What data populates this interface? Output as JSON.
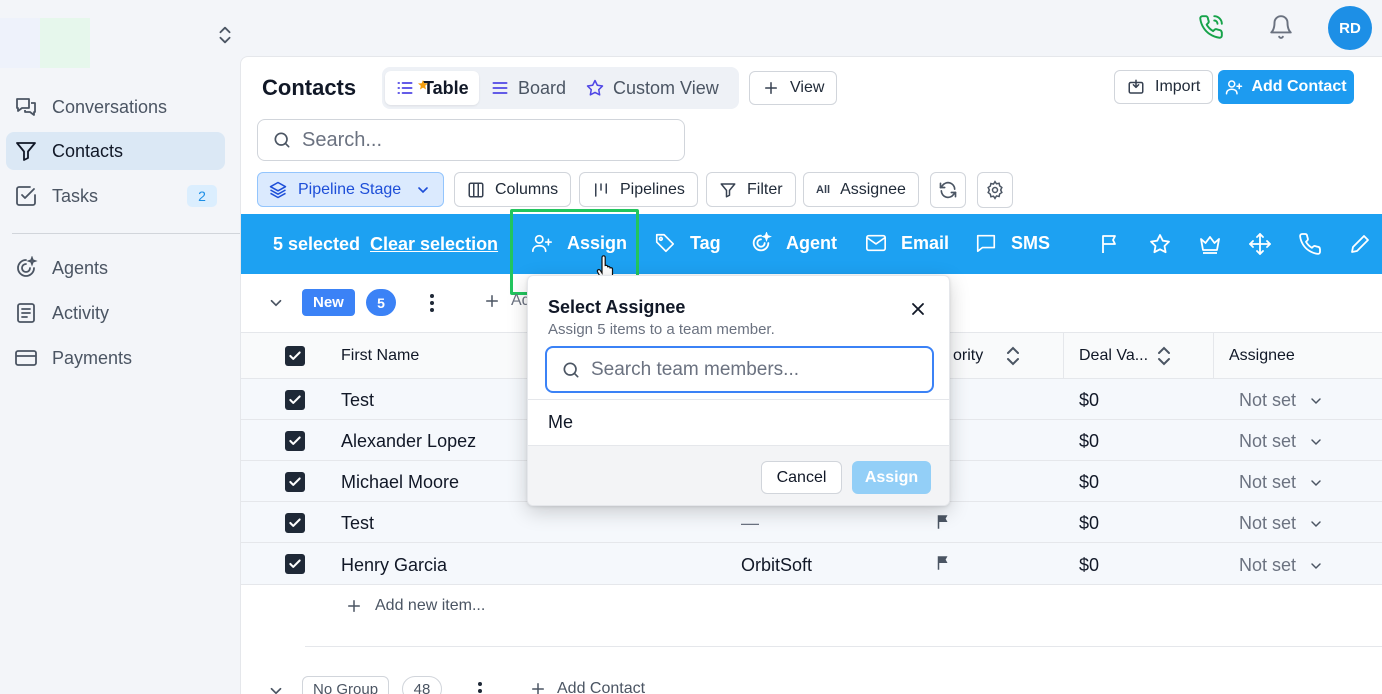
{
  "topbar": {
    "avatar_initials": "RD",
    "icons": [
      "phone-call-icon",
      "bell-icon",
      "workspace-toggle-icon"
    ]
  },
  "sidebar": {
    "items": [
      {
        "label": "Conversations",
        "icon": "conversations-icon"
      },
      {
        "label": "Contacts",
        "icon": "filter-funnel-icon",
        "active": true
      },
      {
        "label": "Tasks",
        "icon": "checkbox-icon",
        "badge": "2"
      },
      {
        "label": "Agents",
        "icon": "agents-icon"
      },
      {
        "label": "Activity",
        "icon": "activity-icon"
      },
      {
        "label": "Payments",
        "icon": "card-icon"
      }
    ]
  },
  "header": {
    "title": "Contacts",
    "tabs": [
      {
        "label": "Table",
        "active": true
      },
      {
        "label": "Board"
      },
      {
        "label": "Custom View"
      }
    ],
    "view_button": "View",
    "import_button": "Import",
    "add_contact_button": "Add Contact"
  },
  "search": {
    "placeholder": "Search..."
  },
  "toolbar": {
    "pipeline_stage": "Pipeline Stage",
    "columns": "Columns",
    "pipelines": "Pipelines",
    "filter": "Filter",
    "assignee_all_badge": "All",
    "assignee": "Assignee"
  },
  "action_bar": {
    "selected_text": "5 selected",
    "clear_selection": "Clear selection",
    "actions": [
      "Assign",
      "Tag",
      "Agent",
      "Email",
      "SMS"
    ],
    "icon_actions": [
      "flag-icon",
      "star-icon",
      "crown-icon",
      "move-icon",
      "phone-icon",
      "pencil-icon"
    ]
  },
  "group": {
    "name": "New",
    "count": "5",
    "add_label": "Ad"
  },
  "table": {
    "columns": {
      "first_name": "First Name",
      "priority": "ority",
      "deal_value": "Deal Va...",
      "assignee": "Assignee"
    },
    "rows": [
      {
        "first_name": "Test",
        "company": "",
        "deal": "$0",
        "assignee": "Not set",
        "flag": false
      },
      {
        "first_name": "Alexander Lopez",
        "company": "",
        "deal": "$0",
        "assignee": "Not set",
        "flag": false
      },
      {
        "first_name": "Michael Moore",
        "company": "",
        "deal": "$0",
        "assignee": "Not set",
        "flag": false
      },
      {
        "first_name": "Test",
        "company": "—",
        "deal": "$0",
        "assignee": "Not set",
        "flag": true
      },
      {
        "first_name": "Henry Garcia",
        "company": "OrbitSoft",
        "deal": "$0",
        "assignee": "Not set",
        "flag": true
      }
    ],
    "add_item": "Add new item..."
  },
  "no_group": {
    "name": "No Group",
    "count": "48",
    "add_label": "Add Contact"
  },
  "assign_popover": {
    "title": "Select Assignee",
    "subtitle": "Assign 5 items to a team member.",
    "search_placeholder": "Search team members...",
    "options": [
      "Me"
    ],
    "cancel": "Cancel",
    "assign": "Assign"
  },
  "colors": {
    "accent": "#1da1f2",
    "primary_button": "#1d9bf0",
    "highlight_box": "#22c55e",
    "avatar": "#1d8fe6"
  }
}
